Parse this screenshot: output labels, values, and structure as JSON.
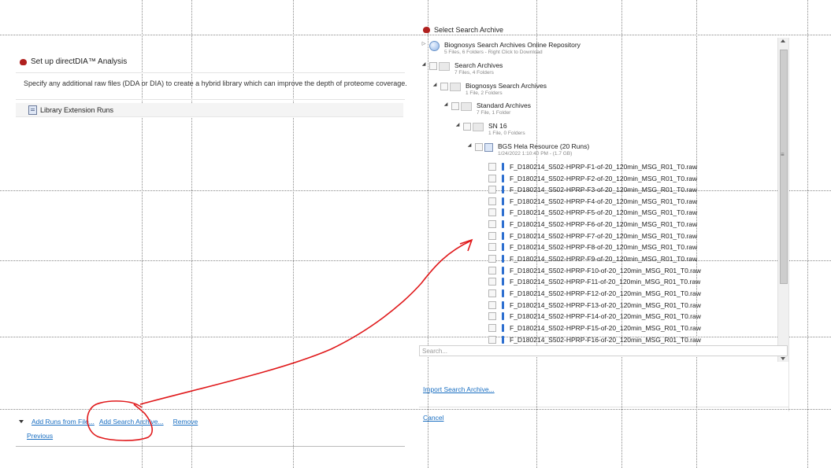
{
  "setup": {
    "title": "Set up directDIA™ Analysis",
    "description": "Specify any additional raw files (DDA or DIA) to create a hybrid library which can improve the depth of proteome coverage.",
    "section_label": "Library Extension Runs",
    "add_runs_link": "Add Runs from File...",
    "add_archive_link": "Add Search Archive...",
    "remove_link": "Remove",
    "previous_link": "Previous"
  },
  "dialog": {
    "title": "Select Search Archive",
    "online_repo": {
      "name": "Biognosys Search Archives Online Repository",
      "sub": "5 Files, 6 Folders - Right Click to Download"
    },
    "search_archives": {
      "name": "Search Archives",
      "sub": "7 Files, 4 Folders"
    },
    "biognosys_archives": {
      "name": "Biognosys Search Archives",
      "sub": "1 File, 2 Folders"
    },
    "standard_archives": {
      "name": "Standard Archives",
      "sub": "7 File, 1 Folder"
    },
    "sn16": {
      "name": "SN 16",
      "sub": "1 File, 0 Folders"
    },
    "hela": {
      "name": "BGS Hela Resource (20 Runs)",
      "sub": "1/24/2022 1:10:40 PM - (1.7 GB)"
    },
    "files": [
      "F_D180214_S502-HPRP-F1-of-20_120min_MSG_R01_T0.raw",
      "F_D180214_S502-HPRP-F2-of-20_120min_MSG_R01_T0.raw",
      "F_D180214_S502-HPRP-F3-of-20_120min_MSG_R01_T0.raw",
      "F_D180214_S502-HPRP-F4-of-20_120min_MSG_R01_T0.raw",
      "F_D180214_S502-HPRP-F5-of-20_120min_MSG_R01_T0.raw",
      "F_D180214_S502-HPRP-F6-of-20_120min_MSG_R01_T0.raw",
      "F_D180214_S502-HPRP-F7-of-20_120min_MSG_R01_T0.raw",
      "F_D180214_S502-HPRP-F8-of-20_120min_MSG_R01_T0.raw",
      "F_D180214_S502-HPRP-F9-of-20_120min_MSG_R01_T0.raw",
      "F_D180214_S502-HPRP-F10-of-20_120min_MSG_R01_T0.raw",
      "F_D180214_S502-HPRP-F11-of-20_120min_MSG_R01_T0.raw",
      "F_D180214_S502-HPRP-F12-of-20_120min_MSG_R01_T0.raw",
      "F_D180214_S502-HPRP-F13-of-20_120min_MSG_R01_T0.raw",
      "F_D180214_S502-HPRP-F14-of-20_120min_MSG_R01_T0.raw",
      "F_D180214_S502-HPRP-F15-of-20_120min_MSG_R01_T0.raw",
      "F_D180214_S502-HPRP-F16-of-20_120min_MSG_R01_T0.raw"
    ],
    "search_placeholder": "Search...",
    "import_link": "Import Search Archive...",
    "cancel_link": "Cancel"
  },
  "colors": {
    "link": "#1a6fc2",
    "annotation": "#e0191b",
    "app_icon": "#b0201e",
    "raw_icon": "#2d6fd0"
  }
}
